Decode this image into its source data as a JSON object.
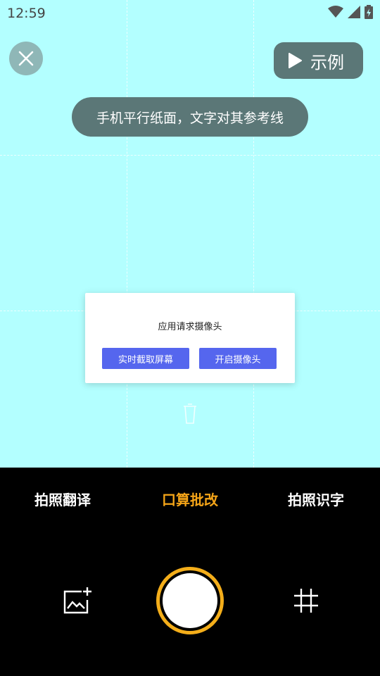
{
  "status_bar": {
    "time": "12:59",
    "icons": [
      "wifi-icon",
      "signal-icon",
      "battery-charging-icon"
    ]
  },
  "top_controls": {
    "close_icon": "close-icon",
    "example_label": "示例",
    "example_icon": "play-icon"
  },
  "hint": {
    "text": "手机平行纸面，文字对其参考线"
  },
  "dialog": {
    "title": "应用请求摄像头",
    "screen_capture_label": "实时截取屏幕",
    "open_camera_label": "开启摄像头"
  },
  "modes": [
    {
      "label": "拍照翻译",
      "active": false
    },
    {
      "label": "口算批改",
      "active": true
    },
    {
      "label": "拍照识字",
      "active": false
    }
  ],
  "controls": {
    "gallery_icon": "add-image-icon",
    "shutter": "shutter-button",
    "grid_icon": "grid-icon"
  },
  "colors": {
    "viewfinder_bg": "#b3ffff",
    "active_mode": "#f4a418",
    "shutter_ring": "#f4ae1a",
    "dialog_button": "#5566ee",
    "overlay_button": "#5b7777"
  }
}
